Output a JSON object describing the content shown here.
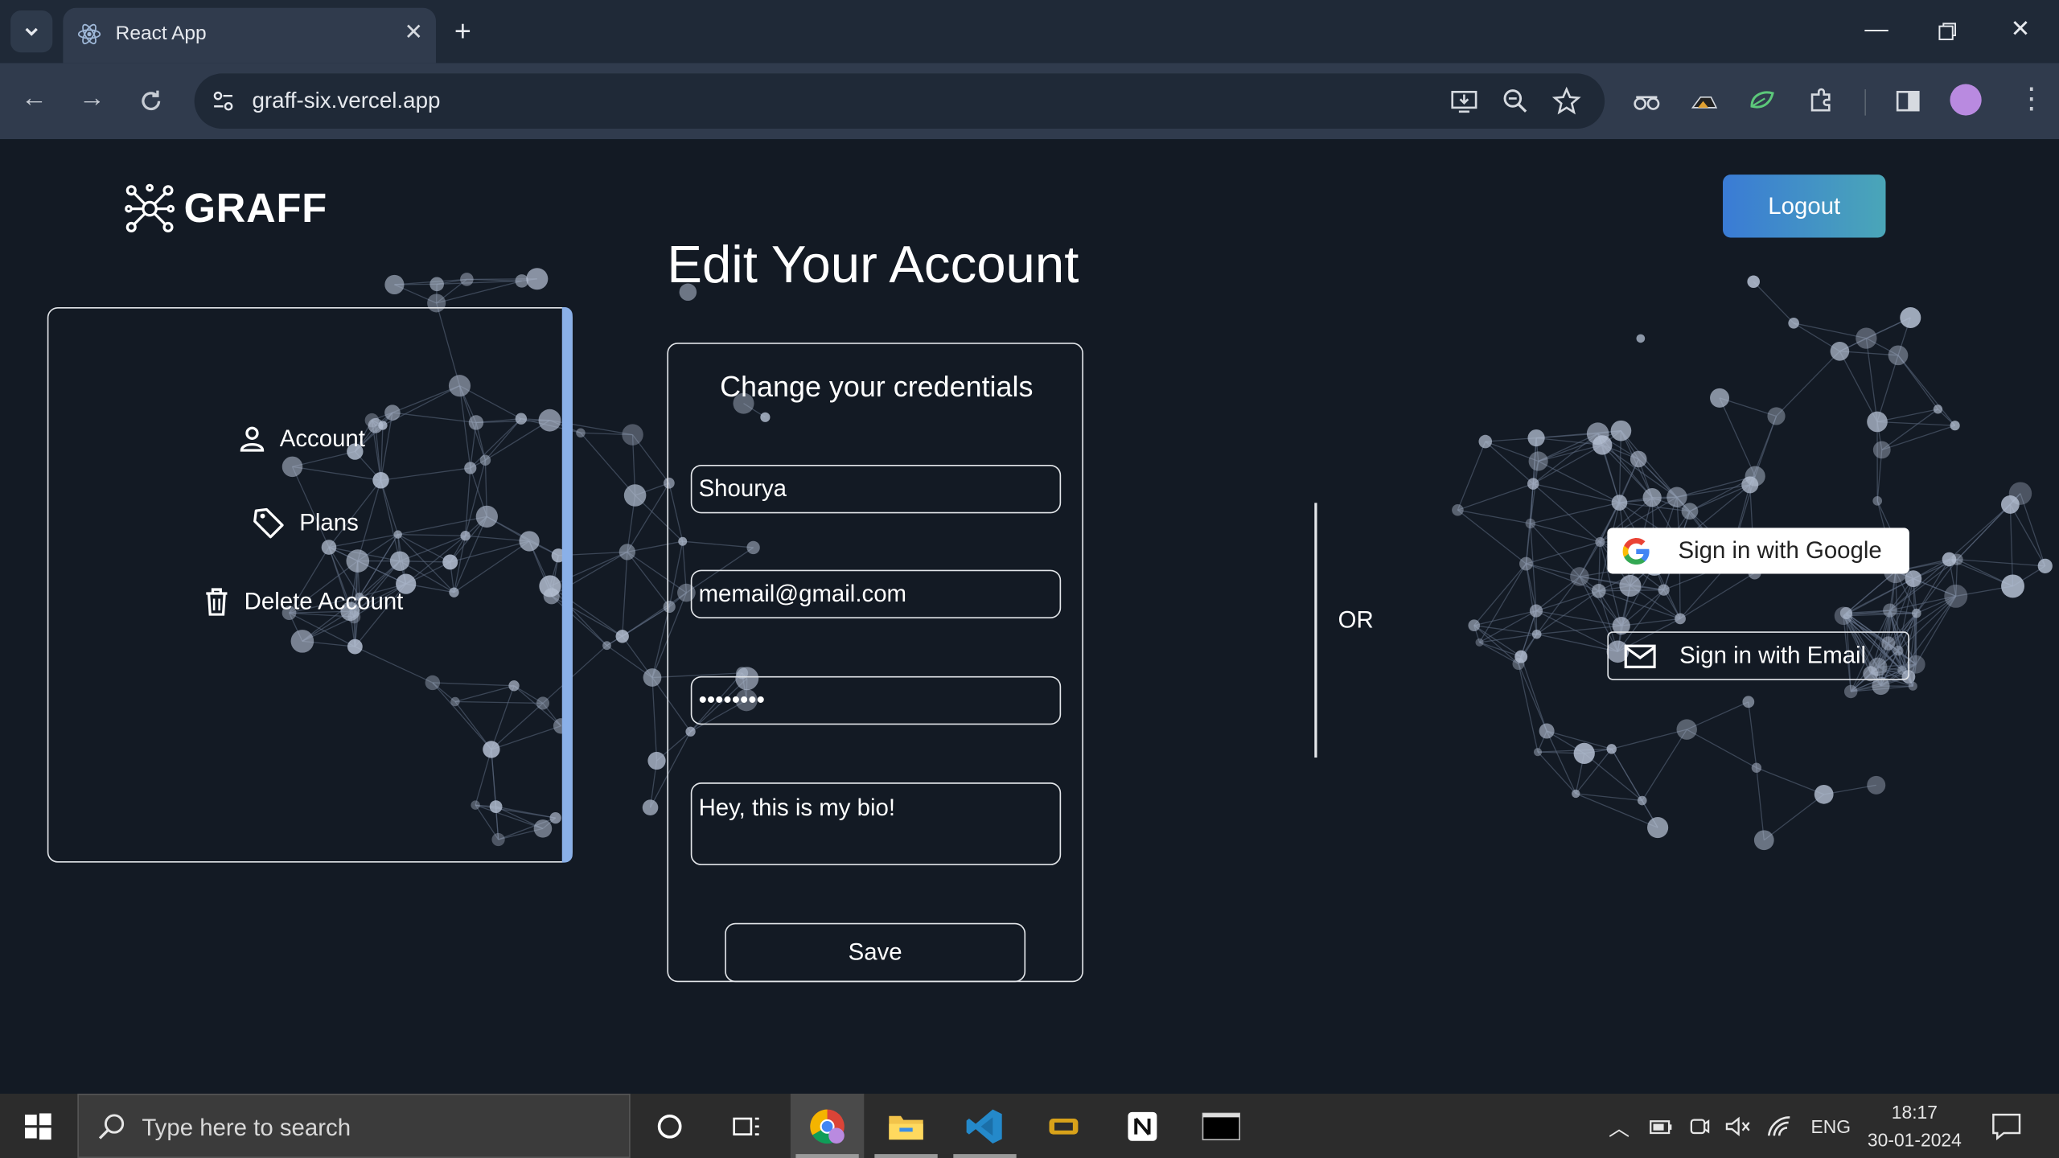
{
  "browser": {
    "tab_title": "React App",
    "url": "graff-six.vercel.app"
  },
  "header": {
    "logo_text": "GRAFF",
    "logout_label": "Logout"
  },
  "page_title": "Edit Your Account",
  "sidebar": {
    "items": [
      {
        "label": "Account",
        "icon": "user-icon"
      },
      {
        "label": "Plans",
        "icon": "tag-icon"
      },
      {
        "label": "Delete Account",
        "icon": "trash-icon"
      }
    ]
  },
  "form": {
    "title": "Change your credentials",
    "name_value": "Shourya",
    "email_value": "memail@gmail.com",
    "password_value": "••••••••",
    "bio_value": "Hey, this is my bio!",
    "save_label": "Save"
  },
  "auth": {
    "or_label": "OR",
    "google_label": "Sign in with Google",
    "email_label": "Sign in with Email"
  },
  "taskbar": {
    "search_placeholder": "Type here to search",
    "language": "ENG",
    "time": "18:17",
    "date": "30-01-2024"
  },
  "colors": {
    "page_bg": "#131a24",
    "accent_gradient_start": "#3a7bd5",
    "accent_gradient_end": "#4aa6b8",
    "sidebar_accent": "#8ab0e8"
  }
}
